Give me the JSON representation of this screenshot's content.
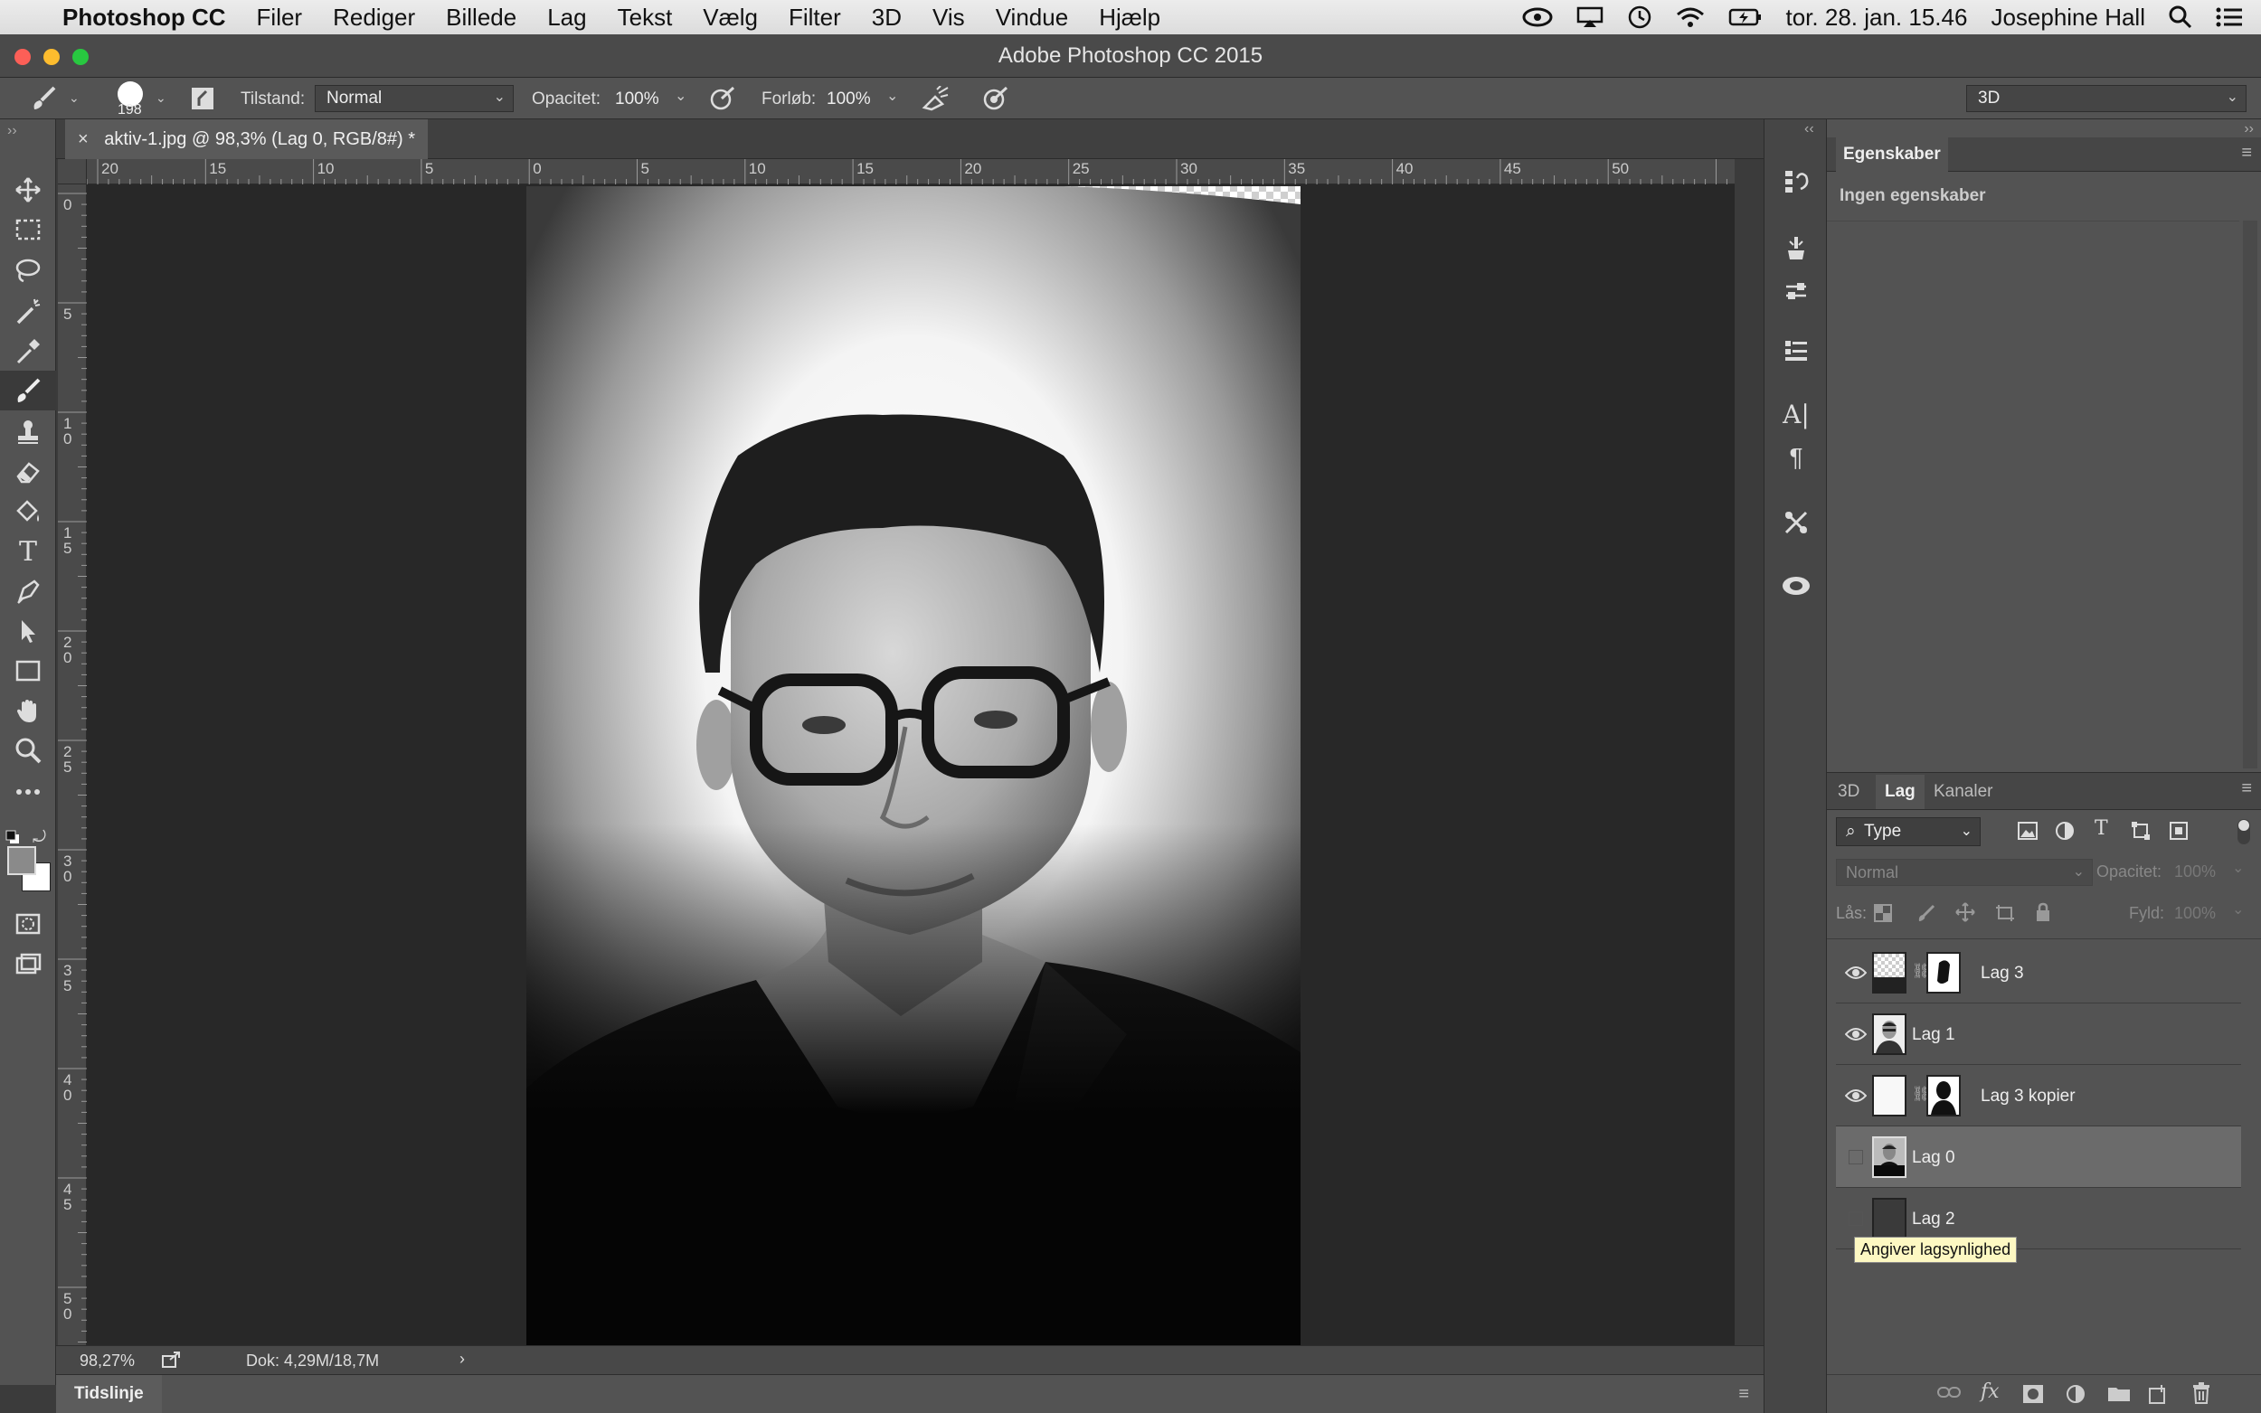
{
  "menubar": {
    "app": "Photoshop CC",
    "items": [
      "Filer",
      "Rediger",
      "Billede",
      "Lag",
      "Tekst",
      "Vælg",
      "Filter",
      "3D",
      "Vis",
      "Vindue",
      "Hjælp"
    ],
    "datetime": "tor. 28. jan. 15.46",
    "user": "Josephine Hall"
  },
  "window": {
    "title": "Adobe Photoshop CC 2015"
  },
  "options": {
    "brush_size": "198",
    "mode_label": "Tilstand:",
    "mode_value": "Normal",
    "opacity_label": "Opacitet:",
    "opacity_value": "100%",
    "flow_label": "Forløb:",
    "flow_value": "100%",
    "workspace": "3D"
  },
  "document": {
    "tab_title": "aktiv-1.jpg @ 98,3% (Lag 0, RGB/8#) *",
    "hruler_ticks": [
      "20",
      "15",
      "10",
      "5",
      "0",
      "5",
      "10",
      "15",
      "20",
      "25",
      "30",
      "35",
      "40",
      "45",
      "50"
    ],
    "vruler_ticks": [
      [
        "0"
      ],
      [
        "5"
      ],
      [
        "1",
        "0"
      ],
      [
        "1",
        "5"
      ],
      [
        "2",
        "0"
      ],
      [
        "2",
        "5"
      ],
      [
        "3",
        "0"
      ],
      [
        "3",
        "5"
      ],
      [
        "4",
        "0"
      ],
      [
        "4",
        "5"
      ],
      [
        "5",
        "0"
      ]
    ],
    "zoom": "98,27%",
    "doc_size": "Dok: 4,29M/18,7M"
  },
  "timeline": {
    "label": "Tidslinje"
  },
  "properties": {
    "tab": "Egenskaber",
    "empty_text": "Ingen egenskaber"
  },
  "layers_panel": {
    "tabs": [
      "3D",
      "Lag",
      "Kanaler"
    ],
    "active_tab": "Lag",
    "filter_kind": "Type",
    "blend_mode": "Normal",
    "opacity_label": "Opacitet:",
    "opacity_value": "100%",
    "lock_label": "Lås:",
    "fill_label": "Fyld:",
    "fill_value": "100%",
    "layers": [
      {
        "name": "Lag 3",
        "visible": true,
        "mask": true
      },
      {
        "name": "Lag 1",
        "visible": true,
        "mask": false
      },
      {
        "name": "Lag 3 kopier",
        "visible": true,
        "mask": true
      },
      {
        "name": "Lag 0",
        "visible": false,
        "mask": false,
        "selected": true
      },
      {
        "name": "Lag 2",
        "visible": false,
        "mask": false
      }
    ],
    "tooltip": "Angiver lagsynlighed"
  },
  "colors": {
    "accent_bg": "#535353",
    "canvas_bg": "#282828",
    "selected_row": "#6b6b6b",
    "tooltip_bg": "#fdf8c2"
  }
}
